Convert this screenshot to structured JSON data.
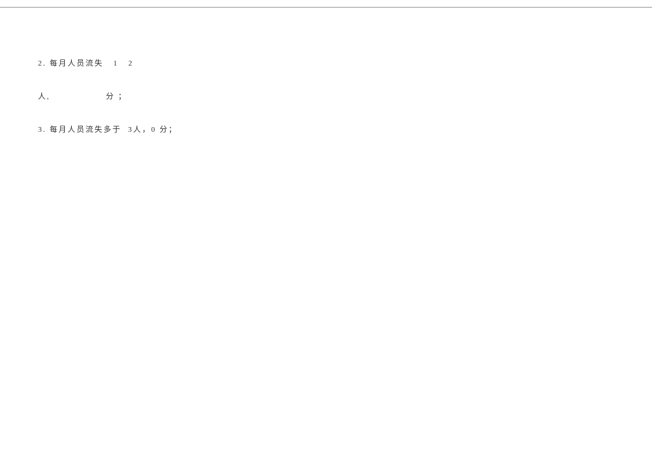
{
  "document": {
    "item2": {
      "line1": "2. 每月人员流失   1   2",
      "line2": "人,                 分 ；",
      "line3_prefix": "3. 每月人员流失多于  ",
      "line3_rest": "3人，0 分；"
    }
  }
}
